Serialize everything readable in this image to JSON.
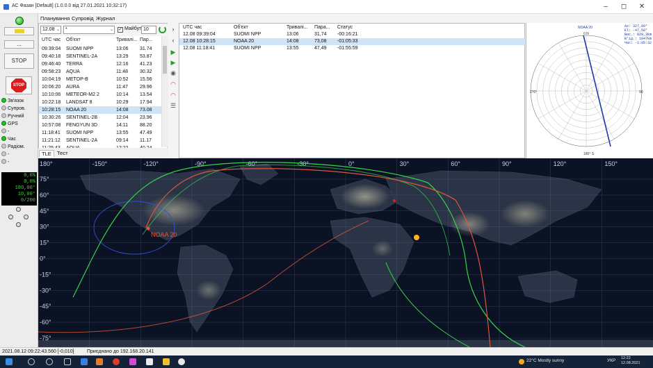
{
  "window": {
    "title": "АС Фазан  [Default] (1.0.0.0 від 27.01.2021 10:32:17)",
    "controls": [
      "–",
      "◻",
      "✕"
    ]
  },
  "menu": [
    "Планування",
    "Супровід",
    "Журнал"
  ],
  "left_panel": {
    "buttons": [
      "...",
      "STOP"
    ],
    "stop_icon_label": "STOP",
    "statuses": [
      {
        "label": "Зв'язок",
        "on": true
      },
      {
        "label": "Супров.",
        "on": false
      },
      {
        "label": "Ручний",
        "on": false
      },
      {
        "label": "GPS",
        "on": true
      },
      {
        "label": "-",
        "on": false
      },
      {
        "label": "Час",
        "on": true
      },
      {
        "label": "Радіом.",
        "on": false
      },
      {
        "label": "-",
        "on": false
      },
      {
        "label": "-",
        "on": false
      }
    ],
    "readout": [
      "0,0%",
      "0,0%",
      "180,00°",
      "10,00°",
      "0/200"
    ]
  },
  "schedule": {
    "date": "12.08",
    "filter": "*",
    "future_label": "Майбут",
    "future_checked": true,
    "future_value": "10",
    "columns": [
      "UTC час",
      "Об'єкт",
      "Тривалі...",
      "Пар..."
    ],
    "rows": [
      [
        "09:39:04",
        "SUOMI NPP",
        "13:06",
        "31.74"
      ],
      [
        "09:40:18",
        "SENTINEL-2A",
        "13:29",
        "53.87"
      ],
      [
        "09:46:40",
        "TERRA",
        "12:16",
        "41.23"
      ],
      [
        "09:58:23",
        "AQUA",
        "11:48",
        "30.32"
      ],
      [
        "10:04:19",
        "METOP-B",
        "10:52",
        "15.56"
      ],
      [
        "10:06:20",
        "AURA",
        "11:47",
        "29.96"
      ],
      [
        "10:10:06",
        "METEOR-M2 2",
        "10:14",
        "13.54"
      ],
      [
        "10:22:18",
        "LANDSAT 8",
        "10:29",
        "17.94"
      ],
      [
        "10:28:15",
        "NOAA 20",
        "14:08",
        "73.08"
      ],
      [
        "10:30:26",
        "SENTINEL-2B",
        "12:04",
        "23.96"
      ],
      [
        "10:57:08",
        "FENGYUN 3D",
        "14:11",
        "88.20"
      ],
      [
        "11:18:41",
        "SUOMI NPP",
        "13:55",
        "47.49"
      ],
      [
        "11:21:12",
        "SENTINEL-2A",
        "09:14",
        "11.17"
      ],
      [
        "11:25:43",
        "AQUA",
        "12:22",
        "40.24"
      ]
    ],
    "selected_index": 8,
    "tabs": [
      "TLE",
      "Тест"
    ]
  },
  "passes": {
    "columns": [
      "UTC час",
      "Об'єкт",
      "Тривалі...",
      "Пара...",
      "Статус"
    ],
    "rows": [
      [
        "12.08 09:39:04",
        "SUOMI NPP",
        "13:06",
        "31,74",
        "-00:16:21"
      ],
      [
        "12.08 10:28:15",
        "NOAA 20",
        "14:08",
        "73,08",
        "-01:05:33"
      ],
      [
        "12.08 11:18:41",
        "SUOMI NPP",
        "13:55",
        "47,49",
        "-01:55:59"
      ]
    ],
    "selected_index": 1
  },
  "polar": {
    "label": "NOAA 20",
    "info": [
      "Az: 327,09°",
      "El: -47,58°",
      "Вис.: 829,3km",
      "В'ід.: 1047km",
      "Час: -1:05:32"
    ],
    "az_labels": [
      "0 N",
      "90",
      "180° S",
      "270°"
    ]
  },
  "map": {
    "lon_labels": [
      "180°",
      "-150°",
      "-120°",
      "-90°",
      "-60°",
      "-30°",
      "0°",
      "30°",
      "60°",
      "90°",
      "120°",
      "150°"
    ],
    "lat_labels": [
      "75°",
      "60°",
      "45°",
      "30°",
      "15°",
      "0°",
      "-15°",
      "-30°",
      "-45°",
      "-60°",
      "-75°"
    ],
    "satellite_label": "NOAA 20"
  },
  "statusbar": {
    "time": "2021.08.12 09:22:43.560 [-0,010]",
    "message": "Приєднано до 192.168.20.141"
  },
  "taskbar": {
    "weather": "22°C  Mostly sunny",
    "lang": "УКР",
    "time": "12:22",
    "date": "12.08.2021"
  },
  "colors": {
    "selection": "#cfe5f7",
    "track_green": "#39d34a",
    "track_red": "#e0553a",
    "coverage": "#2c4fd6",
    "polar_track": "#1f3aa0"
  }
}
